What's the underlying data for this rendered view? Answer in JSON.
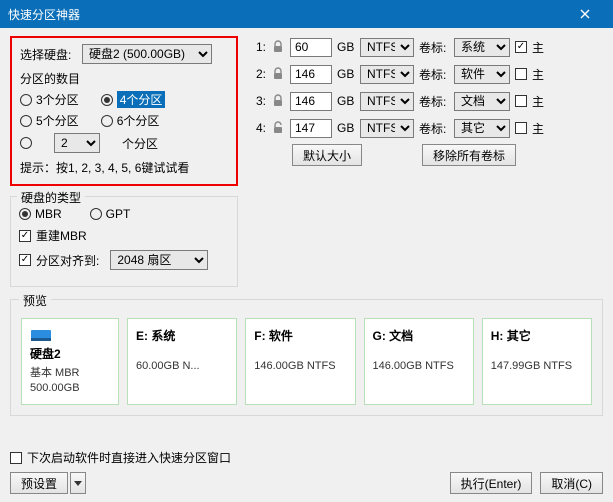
{
  "title": "快速分区神器",
  "left": {
    "selectDiskLabel": "选择硬盘:",
    "diskSelected": "硬盘2 (500.00GB)",
    "partCountLabel": "分区的数目",
    "r3": "3个分区",
    "r4": "4个分区",
    "r5": "5个分区",
    "r6": "6个分区",
    "customCount": "2",
    "customSuffix": "个分区",
    "hint": "提示：按1, 2, 3, 4, 5, 6键试试看"
  },
  "table": {
    "gb": "GB",
    "fs": "NTFS",
    "volLabel": "卷标:",
    "primary": "主",
    "rows": [
      {
        "idx": "1:",
        "locked": true,
        "size": "60",
        "vol": "系统",
        "primaryChecked": true
      },
      {
        "idx": "2:",
        "locked": true,
        "size": "146",
        "vol": "软件",
        "primaryChecked": false
      },
      {
        "idx": "3:",
        "locked": true,
        "size": "146",
        "vol": "文档",
        "primaryChecked": false
      },
      {
        "idx": "4:",
        "locked": false,
        "size": "147",
        "vol": "其它",
        "primaryChecked": false
      }
    ],
    "defaultSizeBtn": "默认大小",
    "clearLabelsBtn": "移除所有卷标"
  },
  "typeBox": {
    "legend": "硬盘的类型",
    "mbr": "MBR",
    "gpt": "GPT",
    "rebuild": "重建MBR",
    "alignLabel": "分区对齐到:",
    "alignValue": "2048 扇区"
  },
  "preview": {
    "legend": "预览",
    "disk": {
      "name": "硬盘2",
      "sub": "基本 MBR",
      "size": "500.00GB"
    },
    "parts": [
      {
        "name": "E: 系统",
        "info": "60.00GB N..."
      },
      {
        "name": "F: 软件",
        "info": "146.00GB NTFS"
      },
      {
        "name": "G: 文档",
        "info": "146.00GB NTFS"
      },
      {
        "name": "H: 其它",
        "info": "147.99GB NTFS"
      }
    ]
  },
  "bottom": {
    "nextTime": "下次启动软件时直接进入快速分区窗口",
    "preset": "预设置",
    "execute": "执行(Enter)",
    "cancel": "取消(C)"
  }
}
